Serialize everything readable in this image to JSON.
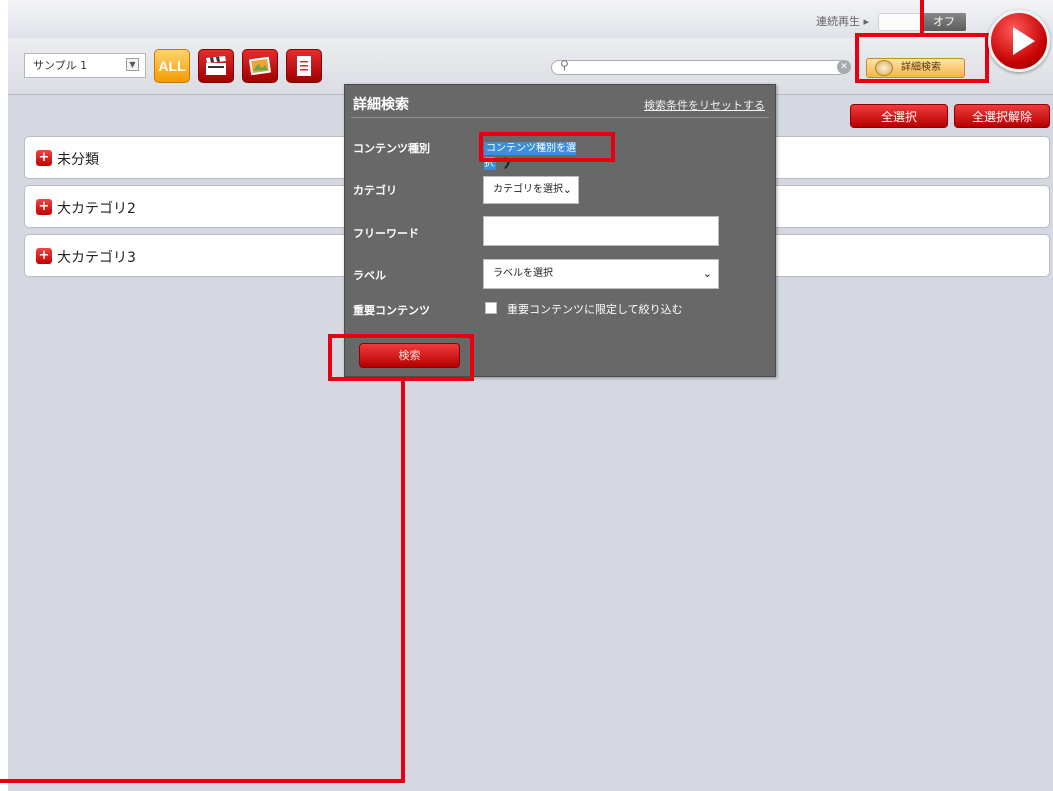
{
  "topbar": {
    "autoplay_label": "連続再生 ▸",
    "autoplay_off": "オフ"
  },
  "toolbar": {
    "folder_select_value": "サンプル 1",
    "filter_all_label": "ALL",
    "search_placeholder": "",
    "advanced_search_label": "詳細検索"
  },
  "actions": {
    "select_all": "全選択",
    "deselect_all": "全選択解除"
  },
  "categories": [
    {
      "name": "未分類"
    },
    {
      "name": "大カテゴリ2"
    },
    {
      "name": "大カテゴリ3"
    }
  ],
  "panel": {
    "title": "詳細検索",
    "reset_link": "検索条件をリセットする",
    "content_type_label": "コンテンツ種別",
    "content_type_value": "コンテンツ種別を選択",
    "category_label": "カテゴリ",
    "category_value": "カテゴリを選択",
    "freeword_label": "フリーワード",
    "freeword_value": "",
    "label_label": "ラベル",
    "label_value": "ラベルを選択",
    "important_label": "重要コンテンツ",
    "important_checkbox_label": "重要コンテンツに限定して絞り込む",
    "search_button": "検索"
  },
  "colors": {
    "accent_red": "#e60012",
    "panel_bg": "#686868",
    "workspace_bg": "#d5d8e0",
    "highlight_orange": "#f5b54d"
  }
}
